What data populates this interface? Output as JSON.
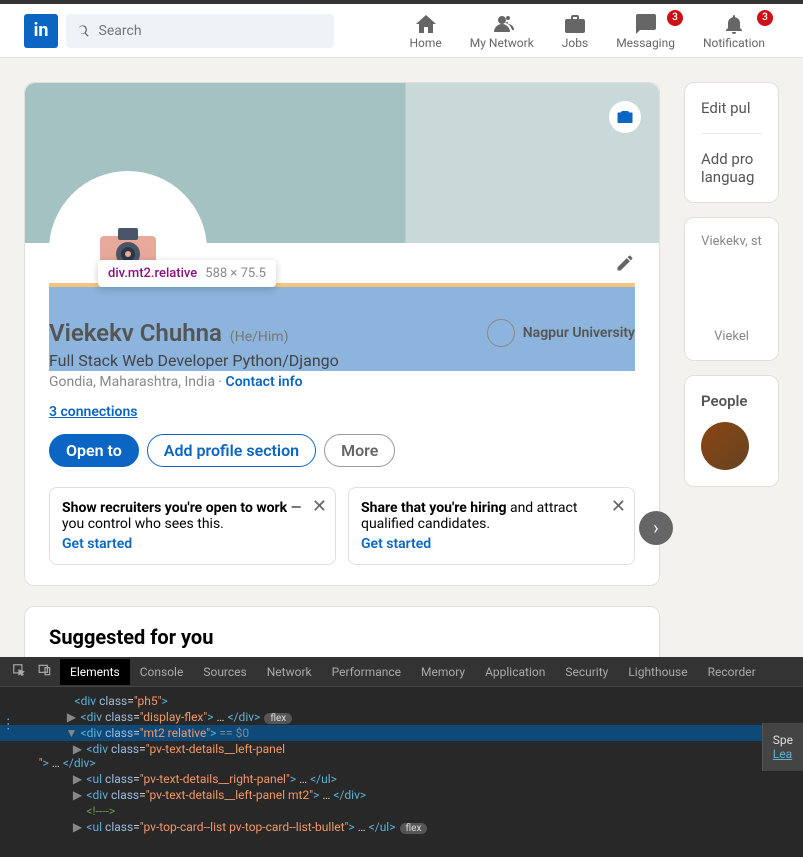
{
  "nav": {
    "logo_text": "in",
    "search_placeholder": "Search",
    "items": [
      {
        "label": "Home"
      },
      {
        "label": "My Network"
      },
      {
        "label": "Jobs"
      },
      {
        "label": "Messaging",
        "badge": "3"
      },
      {
        "label": "Notification",
        "badge": "3"
      }
    ]
  },
  "tooltip": {
    "selector": "div.mt2.relative",
    "dimensions": "588 × 75.5"
  },
  "profile": {
    "name": "Viekekv Chuhna",
    "pronoun": "(He/Him)",
    "headline": "Full Stack Web Developer Python/Django",
    "location": "Gondia, Maharashtra, India",
    "contact_label": "Contact info",
    "education": "Nagpur University",
    "connections": "3 connections",
    "buttons": {
      "open_to": "Open to",
      "add_section": "Add profile section",
      "more": "More"
    },
    "cards": [
      {
        "bold": "Show recruiters you're open to work",
        "rest": " — you control who sees this.",
        "link": "Get started"
      },
      {
        "bold": "Share that you're hiring",
        "rest": " and attract qualified candidates.",
        "link": "Get started"
      }
    ]
  },
  "suggested": {
    "title": "Suggested for you"
  },
  "sidebar": {
    "edit_public": "Edit pul",
    "add_lang": "Add pro",
    "add_lang2": "languag",
    "snippet": "Viekekv, st",
    "snippet2": "Viekel",
    "people": "People"
  },
  "devtools": {
    "tabs": [
      "Elements",
      "Console",
      "Sources",
      "Network",
      "Performance",
      "Memory",
      "Application",
      "Security",
      "Lighthouse",
      "Recorder"
    ],
    "active_tab": "Elements",
    "sidebar_hint": "Spe",
    "sidebar_link": "Lea",
    "lines": [
      {
        "indent": 10,
        "arrow": "",
        "html": "<span class='tag-name'>&lt;div</span> <span class='attr-name'>class</span>=<span class='attr-val'>\"ph5\"</span><span class='tag-name'>&gt;</span>"
      },
      {
        "indent": 11,
        "arrow": "▶",
        "html": "<span class='tag-name'>&lt;div</span> <span class='attr-name'>class</span>=<span class='attr-val'>\"display-flex\"</span><span class='tag-name'>&gt;</span> … <span class='tag-name'>&lt;/div&gt;</span><span class='pill'>flex</span>"
      },
      {
        "indent": 11,
        "arrow": "▼",
        "sel": true,
        "html": "<span class='tag-name'>&lt;div</span> <span class='attr-name'>class</span>=<span class='attr-val'>\"mt2 relative\"</span><span class='tag-name'>&gt;</span> <span class='eq'>== $0</span>"
      },
      {
        "indent": 12,
        "arrow": "▶",
        "html": "<span class='tag-name'>&lt;div</span> <span class='attr-name'>class</span>=<span class='attr-val'>\"pv-text-details__left-panel<br>             \"</span><span class='tag-name'>&gt;</span> … <span class='tag-name'>&lt;/div&gt;</span>"
      },
      {
        "indent": 12,
        "arrow": "▶",
        "html": "<span class='tag-name'>&lt;ul</span> <span class='attr-name'>class</span>=<span class='attr-val'>\"pv-text-details__right-panel\"</span><span class='tag-name'>&gt;</span> … <span class='tag-name'>&lt;/ul&gt;</span>"
      },
      {
        "indent": 12,
        "arrow": "▶",
        "html": "<span class='tag-name'>&lt;div</span> <span class='attr-name'>class</span>=<span class='attr-val'>\"pv-text-details__left-panel mt2\"</span><span class='tag-name'>&gt;</span> … <span class='tag-name'>&lt;/div&gt;</span>"
      },
      {
        "indent": 12,
        "arrow": "",
        "html": "<span class='comment'>&lt;!----&gt;</span>"
      },
      {
        "indent": 12,
        "arrow": "▶",
        "html": "<span class='tag-name'>&lt;ul</span> <span class='attr-name'>class</span>=<span class='attr-val'>\"pv-top-card--list pv-top-card--list-bullet\"</span><span class='tag-name'>&gt;</span> … <span class='tag-name'>&lt;/ul&gt;</span><span class='pill'>flex</span>"
      }
    ]
  }
}
